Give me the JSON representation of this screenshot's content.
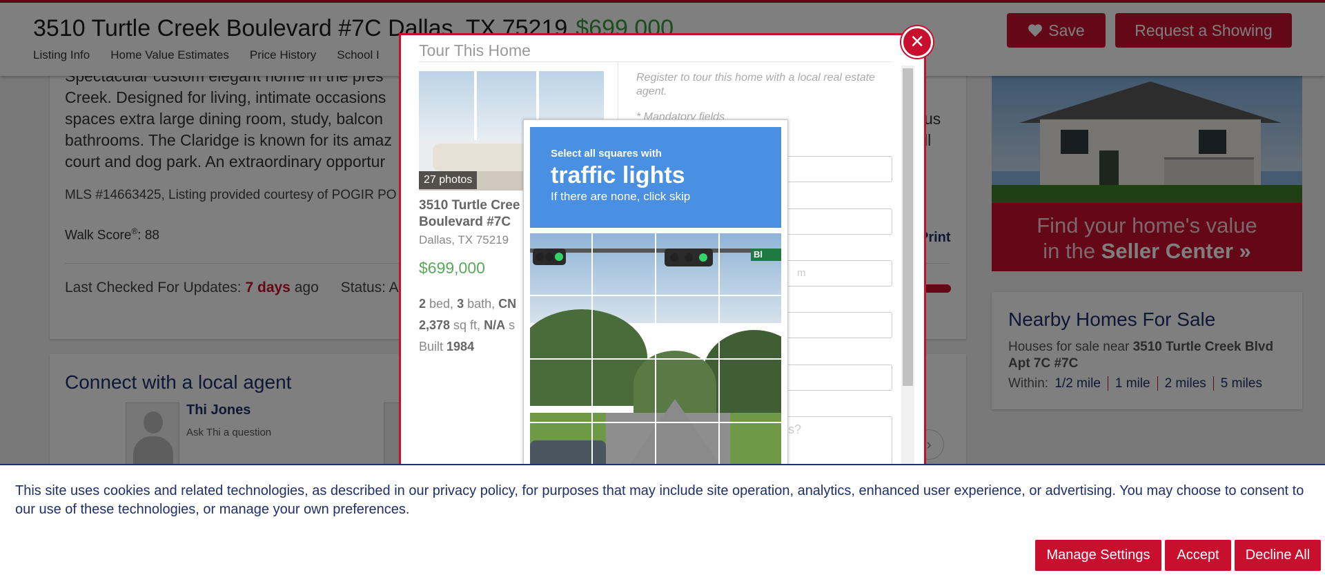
{
  "header": {
    "address": "3510 Turtle Creek Boulevard #7C Dallas, TX 75219",
    "price": "$699,000",
    "nav": [
      "Listing Info",
      "Home Value Estimates",
      "Price History",
      "School I"
    ],
    "save_label": "Save",
    "showing_label": "Request a Showing"
  },
  "listing": {
    "description_lines": [
      "Spectacular custom elegant home in the pres",
      "Creek. Designed for living, intimate occasions",
      "spaces extra large dining room, study, balcon",
      "bathrooms. The Claridge is known for its amaz",
      "court and dog park. An extraordinary opportur"
    ],
    "description_tail": [
      "us",
      "ll"
    ],
    "mls": "MLS #14663425, Listing provided courtesy of POGIR PO",
    "walk_score_label": "Walk Score",
    "walk_score_sup": "®",
    "walk_score_value": ": 88",
    "print_label": "Print",
    "updates_label": "Last Checked For Updates:",
    "updates_days": "7 days",
    "updates_ago": "ago",
    "status_label": "Status: A"
  },
  "agent": {
    "section_title": "Connect with a local agent",
    "name": "Thi Jones",
    "ask": "Ask Thi a question"
  },
  "ad": {
    "line1": "Find your home's value",
    "line2_pre": "in the ",
    "line2_bold": "Seller Center »"
  },
  "nearby": {
    "title": "Nearby Homes For Sale",
    "text_pre": "Houses for sale near ",
    "text_bold": "3510 Turtle Creek Blvd Apt 7C #7C",
    "within_label": "Within:",
    "distances": [
      "1/2 mile",
      "1 mile",
      "2 miles",
      "5 miles"
    ]
  },
  "modal": {
    "title": "Tour This Home",
    "close_icon": "×",
    "photos_badge": "27 photos",
    "address_line1": "3510 Turtle Cree",
    "address_line2": "Boulevard #7C",
    "city": "Dallas, TX 75219",
    "price": "$699,000",
    "spec_beds": "2",
    "spec_beds_label": " bed, ",
    "spec_baths": "3",
    "spec_baths_label": " bath, ",
    "spec_cn": "CN",
    "spec_sqft": "2,378",
    "spec_sqft_label": " sq ft, ",
    "spec_na": "N/A",
    "spec_na_label": " s",
    "built_label": "Built ",
    "built_year": "1984",
    "register_text": "Register to tour this home with a local real estate agent.",
    "mandatory": "* Mandatory fields",
    "field_placeholder_m": "m",
    "textarea_placeholder": "s?"
  },
  "captcha": {
    "instruction_small": "Select all squares with",
    "instruction_big": "traffic lights",
    "instruction_skip": "If there are none, click skip",
    "sign_text": "Bl"
  },
  "cookie": {
    "text": "This site uses cookies and related technologies, as described in our privacy policy, for purposes that may include site operation, analytics, enhanced user experience, or advertising. You may choose to consent to our use of these technologies, or manage your own preferences.",
    "manage_label": "Manage Settings",
    "accept_label": "Accept",
    "decline_label": "Decline All"
  },
  "colors": {
    "brand_red": "#c8102e",
    "navy": "#1f2f6e",
    "price_green": "#3a9a3a",
    "captcha_blue": "#4a90e2"
  },
  "icons": {
    "save": "heart-icon",
    "close": "close-icon",
    "agent_next": "chevron-right-icon"
  }
}
